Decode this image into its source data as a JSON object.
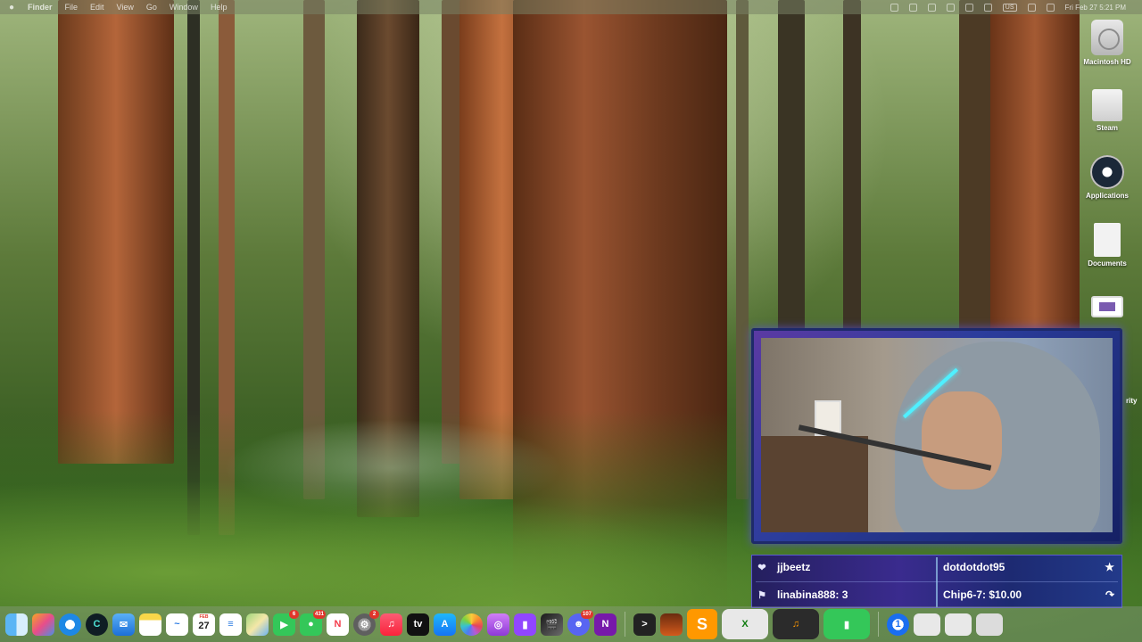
{
  "menubar": {
    "apple": "",
    "items": [
      "Finder",
      "File",
      "Edit",
      "View",
      "Go",
      "Window",
      "Help"
    ],
    "status_input": "US",
    "clock": "Fri Feb 27  5:21 PM"
  },
  "desktop_icons": [
    {
      "label": "Macintosh HD",
      "icon": "hard-drive-icon"
    },
    {
      "label": "Steam",
      "icon": "folder-icon"
    },
    {
      "label": "Applications",
      "icon": "steam-icon"
    },
    {
      "label": "Documents",
      "icon": "document-icon"
    },
    {
      "label": "",
      "icon": "window-icon"
    }
  ],
  "partial_label": "rity",
  "alerts": {
    "follower": "jjbeetz",
    "subscriber": "dotdotdot95",
    "raid": "linabina888: 3",
    "tip": "Chip6-7: $10.00",
    "icons": {
      "follower": "heart-icon",
      "subscriber": "star-icon",
      "raid": "flag-icon",
      "tip": "bits-icon"
    }
  },
  "dock": {
    "calendar_month": "FEB",
    "calendar_day": "27",
    "badges": {
      "facetime": "6",
      "messages": "431",
      "settings": "2",
      "discord": "107"
    },
    "apps": [
      "Finder",
      "Launchpad",
      "Safari",
      "Browser",
      "Mail",
      "Notes",
      "Freeform",
      "Calendar",
      "Reminders",
      "Maps",
      "FaceTime",
      "Messages",
      "News",
      "System Settings",
      "Music",
      "TV",
      "App Store",
      "Photos",
      "Podcasts",
      "Stream Deck",
      "Final Cut",
      "Discord",
      "OneNote",
      "Terminal",
      "Game",
      "Sublime Text",
      "Xbox",
      "GarageBand",
      "Twitch",
      "1Password",
      "Downloads",
      "Trash"
    ]
  },
  "colors": {
    "alert_bg": "#2b2a7a",
    "alert_border": "#5a5bd0",
    "webcam_border": "#1e2a6a"
  }
}
